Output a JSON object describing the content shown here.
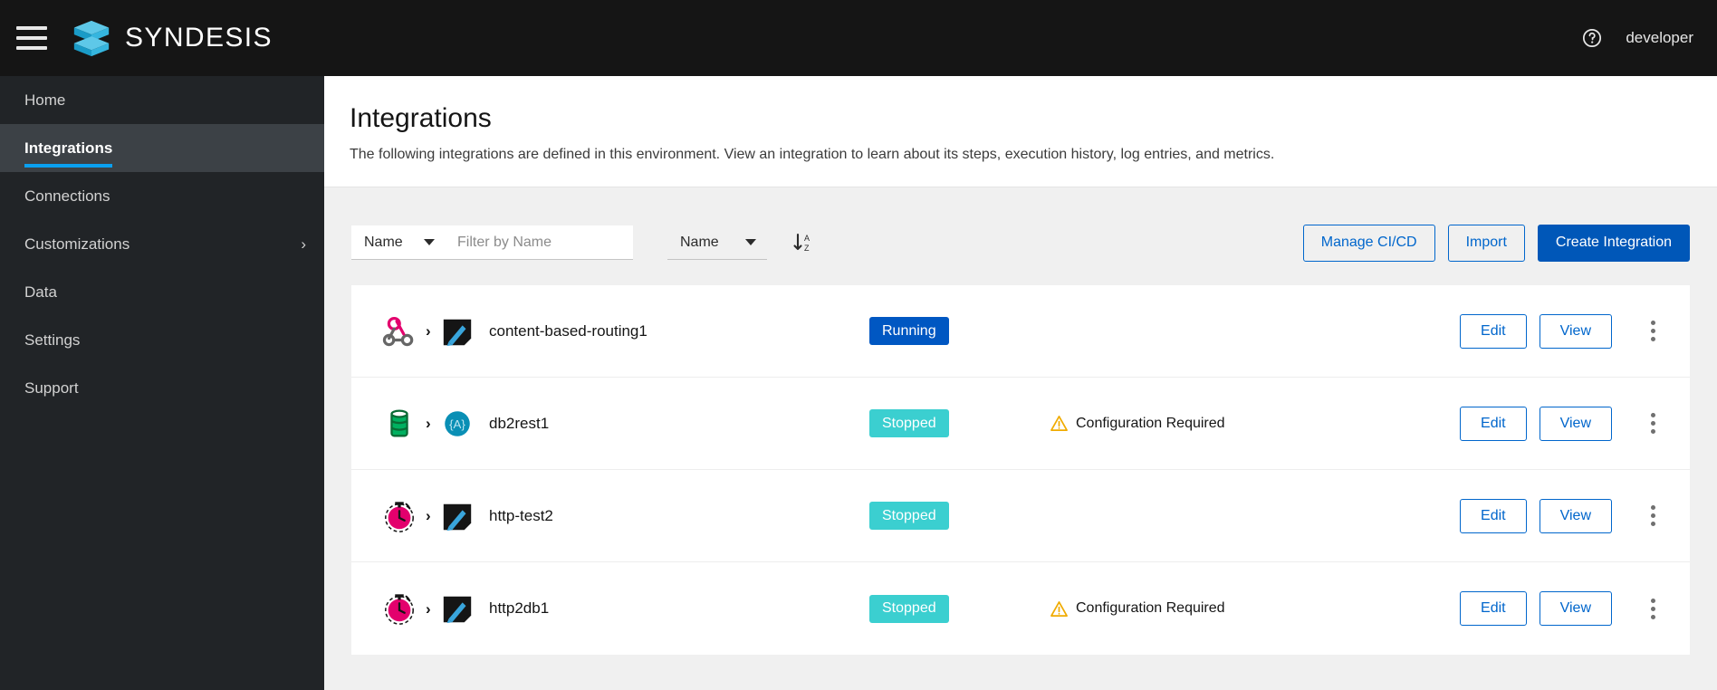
{
  "masthead": {
    "menu_icon": "hamburger-icon",
    "logo_icon": "syndesis-logo-icon",
    "brand": "SYNDESIS",
    "help_icon": "help-circle-icon",
    "username": "developer"
  },
  "sidebar": {
    "items": [
      {
        "label": "Home",
        "active": false,
        "chevron": ""
      },
      {
        "label": "Integrations",
        "active": true,
        "chevron": ""
      },
      {
        "label": "Connections",
        "active": false,
        "chevron": ""
      },
      {
        "label": "Customizations",
        "active": false,
        "chevron": "›"
      },
      {
        "label": "Data",
        "active": false,
        "chevron": ""
      },
      {
        "label": "Settings",
        "active": false,
        "chevron": ""
      },
      {
        "label": "Support",
        "active": false,
        "chevron": ""
      }
    ]
  },
  "page": {
    "title": "Integrations",
    "description": "The following integrations are defined in this environment. View an integration to learn about its steps, execution history, log entries, and metrics."
  },
  "toolbar": {
    "filter_field": {
      "value": "Name",
      "icon": "chevron-down-icon"
    },
    "filter_input": {
      "value": "",
      "placeholder": "Filter by Name"
    },
    "sort_field": {
      "value": "Name",
      "icon": "chevron-down-icon"
    },
    "sort_direction_icon": "sort-alpha-asc-icon",
    "manage_cicd_label": "Manage CI/CD",
    "import_label": "Import",
    "create_integration_label": "Create Integration"
  },
  "colors": {
    "accent_blue": "#0057b8",
    "link_blue": "#0066cc",
    "running_badge": "#0057c2",
    "stopped_badge": "#3bcfd0",
    "warning_orange": "#f0ab00",
    "nav_underline": "#0aa0f0",
    "masthead_bg": "#151515",
    "sidebar_bg": "#212427",
    "sidebar_active_bg": "#3c4146"
  },
  "integrations": [
    {
      "name": "content-based-routing1",
      "start_icon": "webhook-icon",
      "end_icon": "log-step-icon",
      "step_separator": "›",
      "status": "Running",
      "status_color": "#0057c2",
      "warning": "",
      "warning_icon": "",
      "edit_label": "Edit",
      "view_label": "View",
      "menu_icon": "kebab-menu-icon"
    },
    {
      "name": "db2rest1",
      "start_icon": "database-icon",
      "end_icon": "api-provider-icon",
      "step_separator": "›",
      "status": "Stopped",
      "status_color": "#3bcfd0",
      "warning": "Configuration Required",
      "warning_icon": "warning-triangle-icon",
      "edit_label": "Edit",
      "view_label": "View",
      "menu_icon": "kebab-menu-icon"
    },
    {
      "name": "http-test2",
      "start_icon": "timer-icon",
      "end_icon": "log-step-icon",
      "step_separator": "›",
      "status": "Stopped",
      "status_color": "#3bcfd0",
      "warning": "",
      "warning_icon": "",
      "edit_label": "Edit",
      "view_label": "View",
      "menu_icon": "kebab-menu-icon"
    },
    {
      "name": "http2db1",
      "start_icon": "timer-icon",
      "end_icon": "log-step-icon",
      "step_separator": "›",
      "status": "Stopped",
      "status_color": "#3bcfd0",
      "warning": "Configuration Required",
      "warning_icon": "warning-triangle-icon",
      "edit_label": "Edit",
      "view_label": "View",
      "menu_icon": "kebab-menu-icon"
    }
  ]
}
